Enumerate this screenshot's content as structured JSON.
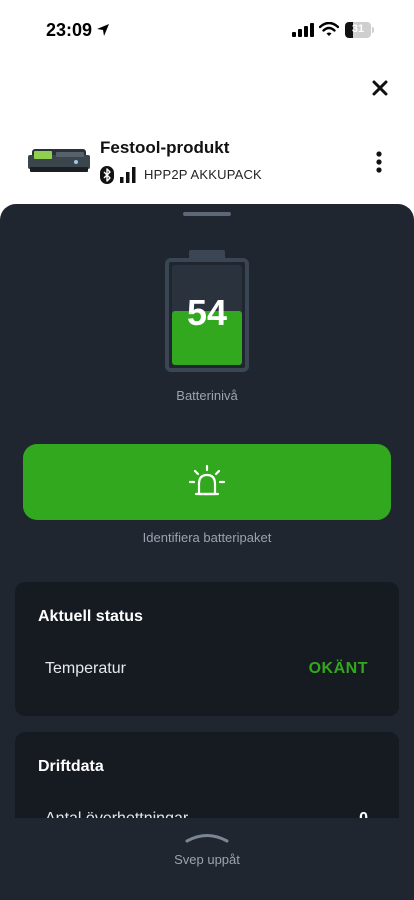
{
  "status_bar": {
    "time": "23:09",
    "battery_percent": "31"
  },
  "product": {
    "title": "Festool-produkt",
    "model": "HPP2P AKKUPACK"
  },
  "battery": {
    "level": 54,
    "level_text": "54",
    "label": "Batterinivå"
  },
  "identify": {
    "label": "Identifiera batteripaket"
  },
  "current_status": {
    "title": "Aktuell status",
    "rows": [
      {
        "label": "Temperatur",
        "value": "OKÄNT"
      }
    ]
  },
  "operating_data": {
    "title": "Driftdata",
    "rows": [
      {
        "label": "Antal överhettningar",
        "value": "0"
      }
    ]
  },
  "swipe": {
    "label": "Svep uppåt"
  },
  "colors": {
    "accent_green": "#32a81e",
    "sheet_bg": "#1f2630",
    "card_bg": "#161b22"
  }
}
